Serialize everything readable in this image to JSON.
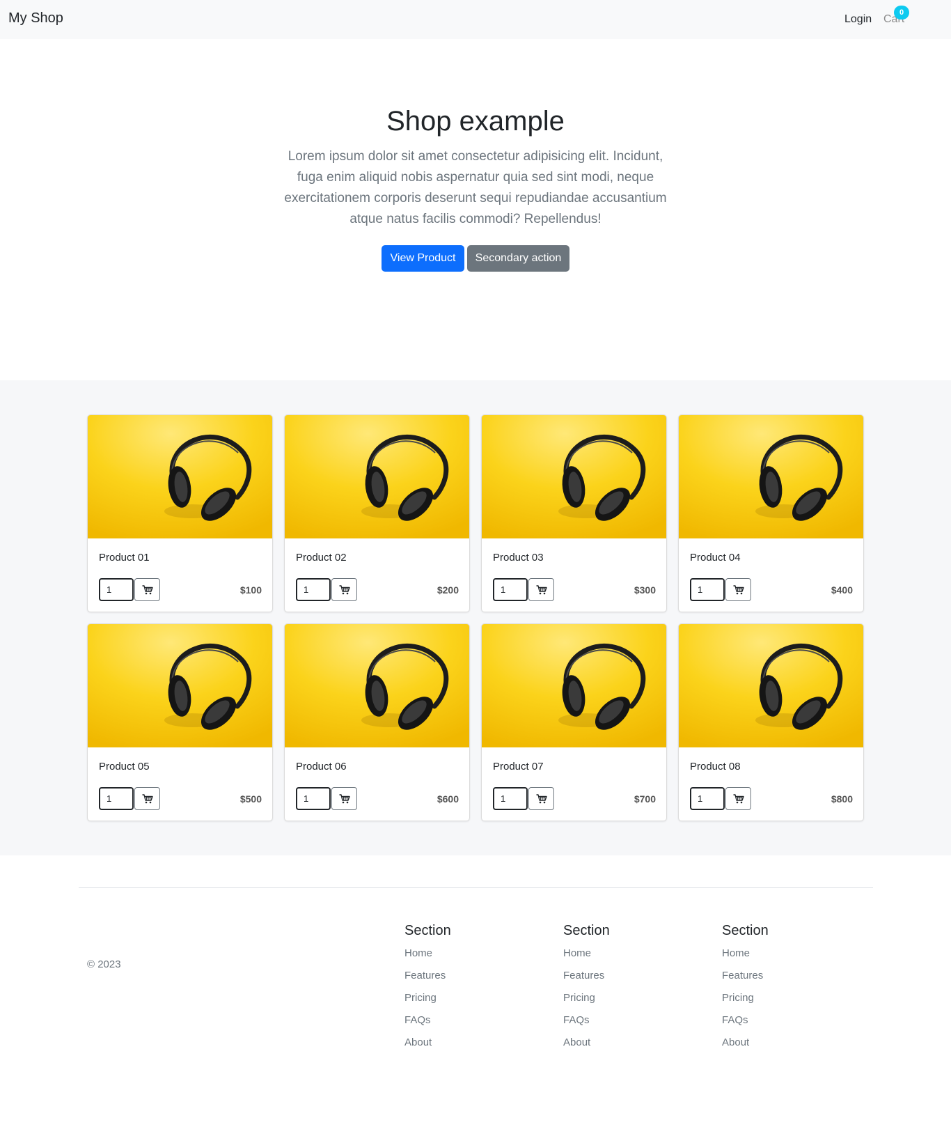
{
  "navbar": {
    "brand": "My Shop",
    "login": "Login",
    "cart": "Cart",
    "cart_count": "0"
  },
  "hero": {
    "title": "Shop example",
    "lead": "Lorem ipsum dolor sit amet consectetur adipisicing elit. Incidunt, fuga enim aliquid nobis aspernatur quia sed sint modi, neque exercitationem corporis deserunt sequi repudiandae accusantium atque natus facilis commodi? Repellendus!",
    "primary_label": "View Product",
    "secondary_label": "Secondary action"
  },
  "products": [
    {
      "name": "Product 01",
      "qty": "1",
      "price": "$100"
    },
    {
      "name": "Product 02",
      "qty": "1",
      "price": "$200"
    },
    {
      "name": "Product 03",
      "qty": "1",
      "price": "$300"
    },
    {
      "name": "Product 04",
      "qty": "1",
      "price": "$400"
    },
    {
      "name": "Product 05",
      "qty": "1",
      "price": "$500"
    },
    {
      "name": "Product 06",
      "qty": "1",
      "price": "$600"
    },
    {
      "name": "Product 07",
      "qty": "1",
      "price": "$700"
    },
    {
      "name": "Product 08",
      "qty": "1",
      "price": "$800"
    }
  ],
  "footer": {
    "copyright": "© 2023",
    "sections": [
      {
        "title": "Section",
        "links": [
          "Home",
          "Features",
          "Pricing",
          "FAQs",
          "About"
        ]
      },
      {
        "title": "Section",
        "links": [
          "Home",
          "Features",
          "Pricing",
          "FAQs",
          "About"
        ]
      },
      {
        "title": "Section",
        "links": [
          "Home",
          "Features",
          "Pricing",
          "FAQs",
          "About"
        ]
      }
    ]
  },
  "colors": {
    "primary": "#0d6efd",
    "secondary": "#6c757d",
    "badge": "#0dcaf0",
    "product_background": "#f8c500"
  },
  "icons": {
    "cart_button": "shopping-cart-icon",
    "product_image": "headphones-image"
  }
}
